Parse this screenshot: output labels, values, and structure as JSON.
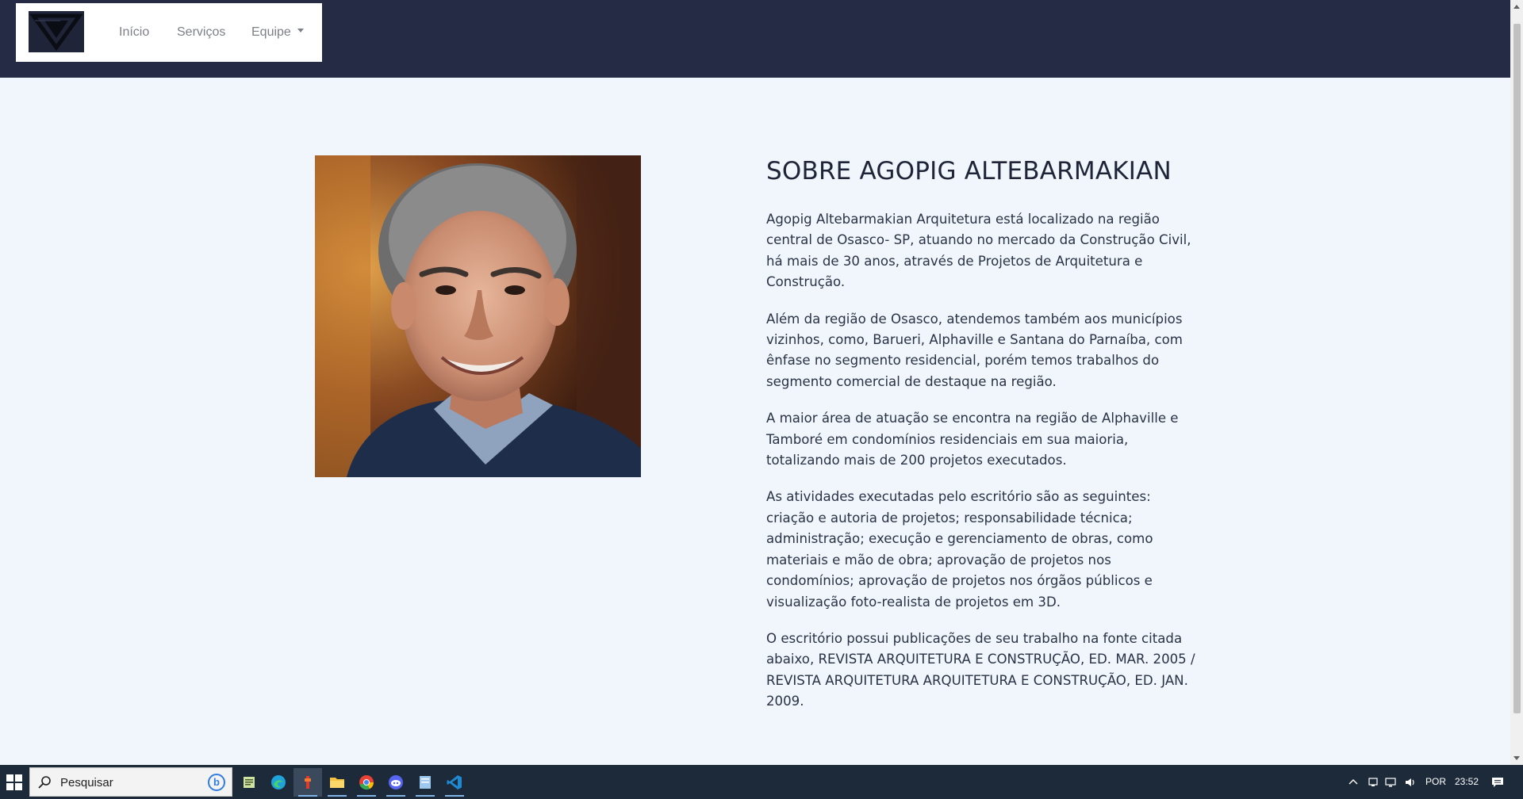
{
  "nav": {
    "items": [
      {
        "label": "Início"
      },
      {
        "label": "Serviços"
      },
      {
        "label": "Equipe"
      }
    ]
  },
  "about": {
    "title": "SOBRE AGOPIG ALTEBARMAKIAN",
    "paragraphs": [
      "Agopig Altebarmakian Arquitetura está localizado na região central de Osasco- SP, atuando no mercado da Construção Civil, há mais de 30 anos, através de Projetos de Arquitetura e Construção.",
      "Além da região de Osasco, atendemos também aos municípios vizinhos, como, Barueri, Alphaville e Santana do Parnaíba, com ênfase no segmento residencial, porém temos trabalhos do segmento comercial de destaque na região.",
      "A maior área de atuação se encontra na região de Alphaville e Tamboré em condomínios residenciais em sua maioria, totalizando mais de 200 projetos executados.",
      "As atividades executadas pelo escritório são as seguintes: criação e autoria de projetos; responsabilidade técnica; administração; execução e gerenciamento de obras, como materiais e mão de obra; aprovação de projetos nos condomínios; aprovação de projetos nos órgãos públicos e visualização foto-realista de projetos em 3D.",
      "O escritório possui publicações de seu trabalho na fonte citada abaixo, REVISTA ARQUITETURA E CONSTRUÇÃO, ED. MAR. 2005 / REVISTA ARQUITETURA ARQUITETURA E CONSTRUÇÃO, ED. JAN. 2009."
    ]
  },
  "taskbar": {
    "search_placeholder": "Pesquisar",
    "language": "POR",
    "time": "23:52",
    "apps": [
      "notepad-icon",
      "edge-icon",
      "app-red-icon",
      "file-explorer-icon",
      "chrome-icon",
      "discord-icon",
      "notes-icon",
      "vscode-icon"
    ]
  },
  "colors": {
    "header_bg": "#252b45",
    "page_bg": "#f0f6fb",
    "title": "#1f2438",
    "taskbar_bg": "#1c2a3a"
  }
}
